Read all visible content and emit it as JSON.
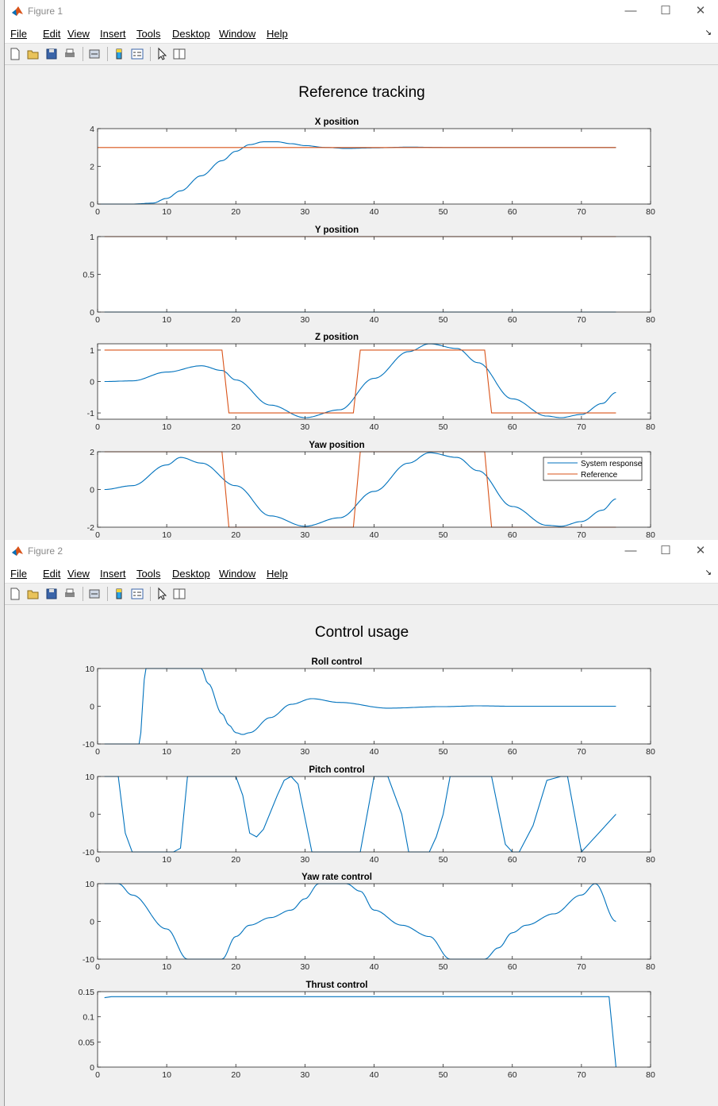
{
  "windows": [
    {
      "title": "Figure 1",
      "super_title": "Reference tracking",
      "menu": [
        "File",
        "Edit",
        "View",
        "Insert",
        "Tools",
        "Desktop",
        "Window",
        "Help"
      ],
      "axes": [
        {
          "title": "X position",
          "xlim": [
            0,
            80
          ],
          "xticks": [
            0,
            10,
            20,
            30,
            40,
            50,
            60,
            70,
            80
          ],
          "ylim": [
            0,
            4
          ],
          "yticks": [
            0,
            2,
            4
          ],
          "ytick_labels": [
            "0",
            "2",
            "4"
          ],
          "series": [
            {
              "name": "System response",
              "color": "#0072BD",
              "kind": "x"
            },
            {
              "name": "Reference",
              "color": "#D95319",
              "kind": "const3"
            }
          ]
        },
        {
          "title": "Y position",
          "xlim": [
            0,
            80
          ],
          "xticks": [
            0,
            10,
            20,
            30,
            40,
            50,
            60,
            70,
            80
          ],
          "ylim": [
            0,
            1
          ],
          "yticks": [
            0,
            0.5,
            1
          ],
          "ytick_labels": [
            "0",
            "0.5",
            "1"
          ],
          "series": [
            {
              "name": "System response",
              "color": "#0072BD",
              "kind": "zero"
            },
            {
              "name": "Reference",
              "color": "#D95319",
              "kind": "const1"
            }
          ]
        },
        {
          "title": "Z position",
          "xlim": [
            0,
            80
          ],
          "xticks": [
            0,
            10,
            20,
            30,
            40,
            50,
            60,
            70,
            80
          ],
          "ylim": [
            -1.2,
            1.2
          ],
          "yticks": [
            -1,
            0,
            1
          ],
          "ytick_labels": [
            "-1",
            "0",
            "1"
          ],
          "series": [
            {
              "name": "System response",
              "color": "#0072BD",
              "kind": "zsys"
            },
            {
              "name": "Reference",
              "color": "#D95319",
              "kind": "zref"
            }
          ]
        },
        {
          "title": "Yaw position",
          "xlim": [
            0,
            80
          ],
          "xticks": [
            0,
            10,
            20,
            30,
            40,
            50,
            60,
            70,
            80
          ],
          "ylim": [
            -2,
            2
          ],
          "yticks": [
            -2,
            0,
            2
          ],
          "ytick_labels": [
            "-2",
            "0",
            "2"
          ],
          "legend": [
            "System response",
            "Reference"
          ],
          "series": [
            {
              "name": "System response",
              "color": "#0072BD",
              "kind": "yawsys"
            },
            {
              "name": "Reference",
              "color": "#D95319",
              "kind": "yawref"
            }
          ]
        }
      ]
    },
    {
      "title": "Figure 2",
      "super_title": "Control usage",
      "menu": [
        "File",
        "Edit",
        "View",
        "Insert",
        "Tools",
        "Desktop",
        "Window",
        "Help"
      ],
      "axes": [
        {
          "title": "Roll control",
          "xlim": [
            0,
            80
          ],
          "xticks": [
            0,
            10,
            20,
            30,
            40,
            50,
            60,
            70,
            80
          ],
          "ylim": [
            -10,
            10
          ],
          "yticks": [
            -10,
            0,
            10
          ],
          "ytick_labels": [
            "-10",
            "0",
            "10"
          ],
          "series": [
            {
              "color": "#0072BD",
              "kind": "roll"
            }
          ]
        },
        {
          "title": "Pitch control",
          "xlim": [
            0,
            80
          ],
          "xticks": [
            0,
            10,
            20,
            30,
            40,
            50,
            60,
            70,
            80
          ],
          "ylim": [
            -10,
            10
          ],
          "yticks": [
            -10,
            0,
            10
          ],
          "ytick_labels": [
            "-10",
            "0",
            "10"
          ],
          "series": [
            {
              "color": "#0072BD",
              "kind": "pitch"
            }
          ]
        },
        {
          "title": "Yaw rate control",
          "xlim": [
            0,
            80
          ],
          "xticks": [
            0,
            10,
            20,
            30,
            40,
            50,
            60,
            70,
            80
          ],
          "ylim": [
            -10,
            10
          ],
          "yticks": [
            -10,
            0,
            10
          ],
          "ytick_labels": [
            "-10",
            "0",
            "10"
          ],
          "series": [
            {
              "color": "#0072BD",
              "kind": "yawrate"
            }
          ]
        },
        {
          "title": "Thrust control",
          "xlim": [
            0,
            80
          ],
          "xticks": [
            0,
            10,
            20,
            30,
            40,
            50,
            60,
            70,
            80
          ],
          "ylim": [
            0,
            0.15
          ],
          "yticks": [
            0,
            0.05,
            0.1,
            0.15
          ],
          "ytick_labels": [
            "0",
            "0.05",
            "0.1",
            "0.15"
          ],
          "series": [
            {
              "color": "#0072BD",
              "kind": "thrust"
            }
          ]
        }
      ]
    }
  ],
  "chart_data": [
    {
      "type": "line",
      "title": "X position",
      "x": [
        0,
        5,
        8,
        10,
        12,
        15,
        18,
        20,
        22,
        24,
        26,
        28,
        30,
        33,
        36,
        40,
        45,
        50,
        55,
        60,
        65,
        70,
        75
      ],
      "series": [
        {
          "name": "System response",
          "values": [
            0,
            0,
            0.05,
            0.3,
            0.7,
            1.5,
            2.3,
            2.8,
            3.15,
            3.3,
            3.3,
            3.2,
            3.1,
            3.0,
            2.95,
            2.98,
            3.02,
            3.0,
            3.0,
            3.0,
            3.0,
            3.0,
            3.0
          ]
        },
        {
          "name": "Reference",
          "values": [
            3,
            3,
            3,
            3,
            3,
            3,
            3,
            3,
            3,
            3,
            3,
            3,
            3,
            3,
            3,
            3,
            3,
            3,
            3,
            3,
            3,
            3,
            3
          ]
        }
      ],
      "xlim": [
        0,
        80
      ],
      "ylim": [
        0,
        4
      ]
    },
    {
      "type": "line",
      "title": "Y position",
      "x": [
        1,
        75
      ],
      "series": [
        {
          "name": "System response",
          "values": [
            0,
            0
          ]
        },
        {
          "name": "Reference",
          "values": [
            1,
            1
          ]
        }
      ],
      "xlim": [
        0,
        80
      ],
      "ylim": [
        0,
        1
      ]
    },
    {
      "type": "line",
      "title": "Z position",
      "x": [
        1,
        5,
        10,
        15,
        18,
        20,
        25,
        30,
        35,
        40,
        45,
        48,
        52,
        55,
        60,
        65,
        67,
        70,
        73,
        75
      ],
      "series": [
        {
          "name": "System response",
          "values": [
            0,
            0.02,
            0.3,
            0.5,
            0.35,
            0.05,
            -0.75,
            -1.15,
            -0.9,
            0.1,
            0.95,
            1.2,
            1.05,
            0.6,
            -0.55,
            -1.1,
            -1.15,
            -1.05,
            -0.7,
            -0.35
          ]
        },
        {
          "name": "Reference",
          "values": [
            1,
            1,
            1,
            1,
            1,
            -1,
            -1,
            -1,
            -1,
            1,
            1,
            1,
            1,
            1,
            -1,
            -1,
            -1,
            -1,
            -1,
            -1
          ]
        }
      ],
      "xlim": [
        0,
        80
      ],
      "ylim": [
        -1.2,
        1.2
      ]
    },
    {
      "type": "line",
      "title": "Yaw position",
      "x": [
        1,
        5,
        10,
        12,
        15,
        20,
        25,
        30,
        35,
        40,
        45,
        48,
        52,
        55,
        60,
        65,
        67,
        70,
        73,
        75
      ],
      "series": [
        {
          "name": "System response",
          "values": [
            0,
            0.2,
            1.3,
            1.7,
            1.4,
            0.2,
            -1.4,
            -1.95,
            -1.5,
            -0.1,
            1.4,
            1.95,
            1.7,
            1.0,
            -0.9,
            -1.9,
            -1.95,
            -1.7,
            -1.1,
            -0.5
          ]
        },
        {
          "name": "Reference",
          "values": [
            2,
            2,
            2,
            2,
            2,
            -2,
            -2,
            -2,
            -2,
            2,
            2,
            2,
            2,
            2,
            -2,
            -2,
            -2,
            -2,
            -2,
            -2
          ]
        }
      ],
      "xlim": [
        0,
        80
      ],
      "ylim": [
        -2,
        2
      ]
    },
    {
      "type": "line",
      "title": "Roll control",
      "x": [
        1,
        6,
        7,
        10,
        15,
        16,
        18,
        19,
        20,
        21,
        22,
        25,
        28,
        31,
        35,
        42,
        50,
        55,
        60,
        65,
        70,
        75
      ],
      "values": [
        -10,
        -10,
        10,
        10,
        10,
        6,
        -2,
        -5,
        -7,
        -7.5,
        -7,
        -3,
        0.5,
        2,
        1,
        -0.5,
        -0.1,
        0.1,
        0,
        0,
        0,
        0
      ],
      "xlim": [
        0,
        80
      ],
      "ylim": [
        -10,
        10
      ]
    },
    {
      "type": "line",
      "title": "Pitch control",
      "x": [
        1,
        3,
        4,
        5,
        11,
        12,
        13,
        20,
        21,
        22,
        23,
        24,
        26,
        27,
        28,
        29,
        31,
        38,
        39,
        40,
        41,
        42,
        44,
        45,
        48,
        49,
        50,
        51,
        52,
        55,
        57,
        59,
        60,
        61,
        63,
        65,
        67,
        68,
        70,
        75
      ],
      "values": [
        10,
        10,
        -5,
        -10,
        -10,
        -9,
        10,
        10,
        5,
        -5,
        -6,
        -4,
        5,
        9,
        10,
        8,
        -10,
        -10,
        0,
        10,
        10,
        10,
        0,
        -10,
        -10,
        -6,
        0,
        10,
        10,
        10,
        10,
        -8,
        -10,
        -10,
        -3,
        9,
        10,
        10,
        -10,
        0
      ],
      "xlim": [
        0,
        80
      ],
      "ylim": [
        -10,
        10
      ]
    },
    {
      "type": "line",
      "title": "Yaw rate control",
      "x": [
        1,
        3,
        5,
        10,
        13,
        18,
        20,
        22,
        25,
        28,
        30,
        32,
        36,
        38,
        40,
        44,
        48,
        51,
        56,
        58,
        60,
        62,
        66,
        70,
        72,
        75
      ],
      "values": [
        10,
        10,
        7,
        -2,
        -10,
        -10,
        -4,
        -1,
        1,
        3,
        6,
        10,
        10,
        8,
        3,
        -1,
        -4,
        -10,
        -10,
        -7,
        -3,
        -1,
        2,
        7,
        10,
        0
      ],
      "xlim": [
        0,
        80
      ],
      "ylim": [
        -10,
        10
      ]
    },
    {
      "type": "line",
      "title": "Thrust control",
      "x": [
        1,
        2,
        74,
        75
      ],
      "values": [
        0.138,
        0.14,
        0.14,
        0
      ],
      "xlim": [
        0,
        80
      ],
      "ylim": [
        0,
        0.15
      ]
    }
  ]
}
